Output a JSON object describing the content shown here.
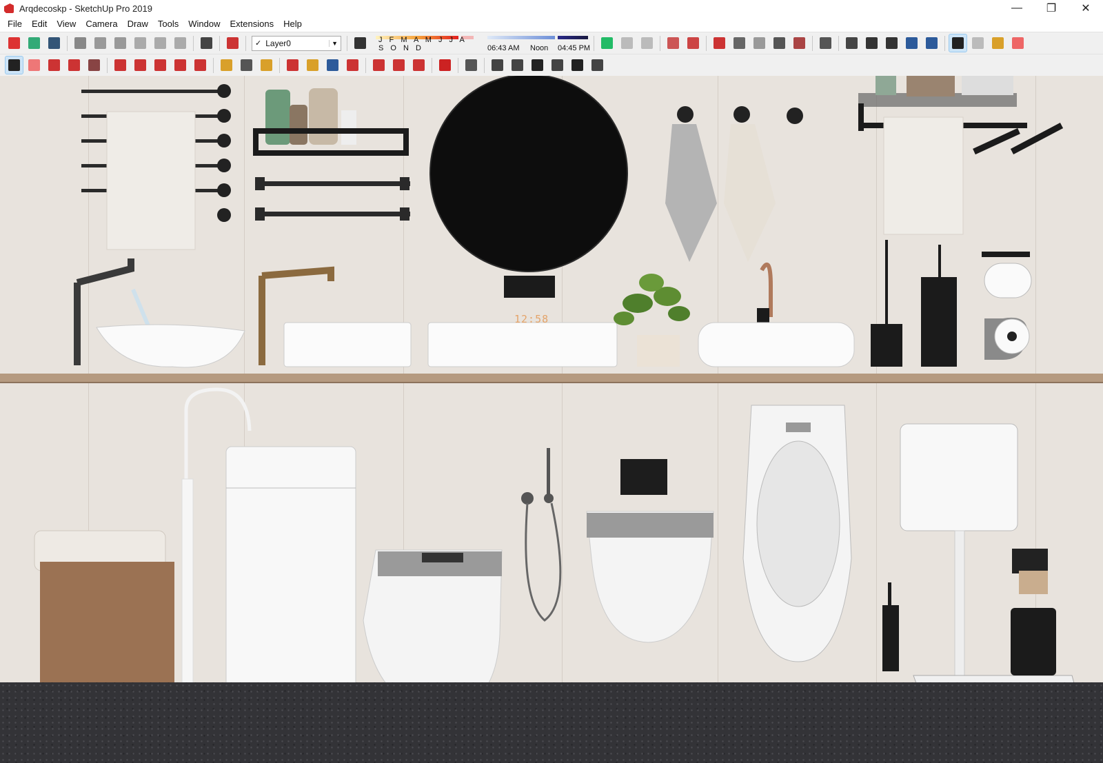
{
  "window": {
    "title": "Arqdecoskp - SketchUp Pro 2019",
    "controls": [
      "—",
      "❐",
      "✕"
    ]
  },
  "menu": [
    "File",
    "Edit",
    "View",
    "Camera",
    "Draw",
    "Tools",
    "Window",
    "Extensions",
    "Help"
  ],
  "layer": {
    "current": "Layer0",
    "check": "✓"
  },
  "shadows": {
    "months": "J F M A M J J A S O N D",
    "time_start": "06:43 AM",
    "time_mid": "Noon",
    "time_end": "04:45 PM"
  },
  "scene": {
    "mirror_clock": "12:58"
  },
  "toolbar_row1": [
    {
      "name": "new-icon",
      "color": "#d33"
    },
    {
      "name": "open-icon",
      "color": "#3a7"
    },
    {
      "name": "save-icon",
      "color": "#357"
    },
    {
      "sep": true
    },
    {
      "name": "cut-icon",
      "color": "#888"
    },
    {
      "name": "copy-icon",
      "color": "#999"
    },
    {
      "name": "paste-icon",
      "color": "#999"
    },
    {
      "name": "erase-icon",
      "color": "#aaa"
    },
    {
      "name": "undo-icon",
      "color": "#aaa"
    },
    {
      "name": "redo-icon",
      "color": "#aaa"
    },
    {
      "sep": true
    },
    {
      "name": "print-icon",
      "color": "#444"
    },
    {
      "sep": true
    },
    {
      "name": "model-info-icon",
      "color": "#c33"
    }
  ],
  "toolbar_row1b": [
    {
      "name": "shadow-toggle-icon",
      "color": "#333"
    }
  ],
  "toolbar_row1c": [
    {
      "name": "get-models-icon",
      "color": "#2b6"
    },
    {
      "name": "share-model-icon",
      "color": "#bbb"
    },
    {
      "name": "extension-icon",
      "color": "#bbb"
    },
    {
      "sep": true
    },
    {
      "name": "sandbox-smoove-icon",
      "color": "#c55"
    },
    {
      "name": "sandbox-grid-icon",
      "color": "#c44"
    },
    {
      "sep": true
    },
    {
      "name": "solid-union-icon",
      "color": "#c33"
    },
    {
      "name": "solid-intersect-icon",
      "color": "#666"
    },
    {
      "name": "solid-trim-icon",
      "color": "#999"
    },
    {
      "name": "solid-split-icon",
      "color": "#555"
    },
    {
      "name": "solid-subtract-icon",
      "color": "#a44"
    },
    {
      "sep": true
    },
    {
      "name": "component-icon",
      "color": "#555"
    },
    {
      "sep": true
    },
    {
      "name": "xray-icon",
      "color": "#444"
    },
    {
      "name": "wireframe-icon",
      "color": "#333"
    },
    {
      "name": "hidden-line-icon",
      "color": "#333"
    },
    {
      "name": "shaded-icon",
      "color": "#2c5a9a"
    },
    {
      "name": "textured-icon",
      "color": "#2c5a9a"
    },
    {
      "sep": true
    },
    {
      "name": "select-icon",
      "color": "#222",
      "active": true
    },
    {
      "name": "eraser-icon",
      "color": "#bbb"
    },
    {
      "name": "paint-bucket-icon",
      "color": "#d9a02a"
    },
    {
      "name": "pink-eraser-icon",
      "color": "#e66"
    }
  ],
  "toolbar_row2": [
    {
      "name": "select-arrow-icon",
      "color": "#222",
      "active": true
    },
    {
      "name": "eraser-tool-icon",
      "color": "#e77"
    },
    {
      "name": "pencil-line-icon",
      "color": "#c33"
    },
    {
      "name": "arc-icon",
      "color": "#c33"
    },
    {
      "name": "rectangle-icon",
      "color": "#844"
    },
    {
      "sep": true
    },
    {
      "name": "push-pull-icon",
      "color": "#c33"
    },
    {
      "name": "follow-me-icon",
      "color": "#c33"
    },
    {
      "name": "move-icon",
      "color": "#c33"
    },
    {
      "name": "rotate-icon",
      "color": "#c33"
    },
    {
      "name": "scale-icon",
      "color": "#c33"
    },
    {
      "sep": true
    },
    {
      "name": "tape-measure-icon",
      "color": "#d9a02a"
    },
    {
      "name": "text-icon",
      "color": "#555"
    },
    {
      "name": "paint-icon",
      "color": "#d9a02a"
    },
    {
      "sep": true
    },
    {
      "name": "orbit-icon",
      "color": "#c33"
    },
    {
      "name": "pan-icon",
      "color": "#d9a02a"
    },
    {
      "name": "zoom-icon",
      "color": "#2c5a9a"
    },
    {
      "name": "zoom-extents-icon",
      "color": "#c33"
    },
    {
      "sep": true
    },
    {
      "name": "warehouse-icon",
      "color": "#c33"
    },
    {
      "name": "extension-warehouse-icon",
      "color": "#c33"
    },
    {
      "name": "layout-icon",
      "color": "#c33"
    },
    {
      "sep": true
    },
    {
      "name": "ruby-icon",
      "color": "#c22"
    },
    {
      "sep": true
    },
    {
      "name": "account-icon",
      "color": "#555"
    },
    {
      "sep": true
    },
    {
      "name": "iso-view-icon",
      "color": "#444"
    },
    {
      "name": "right-view-icon",
      "color": "#444"
    },
    {
      "name": "front-view-icon",
      "color": "#222"
    },
    {
      "name": "back-view-icon",
      "color": "#444"
    },
    {
      "name": "left-view-icon",
      "color": "#222"
    },
    {
      "name": "top-view-icon",
      "color": "#444"
    }
  ]
}
